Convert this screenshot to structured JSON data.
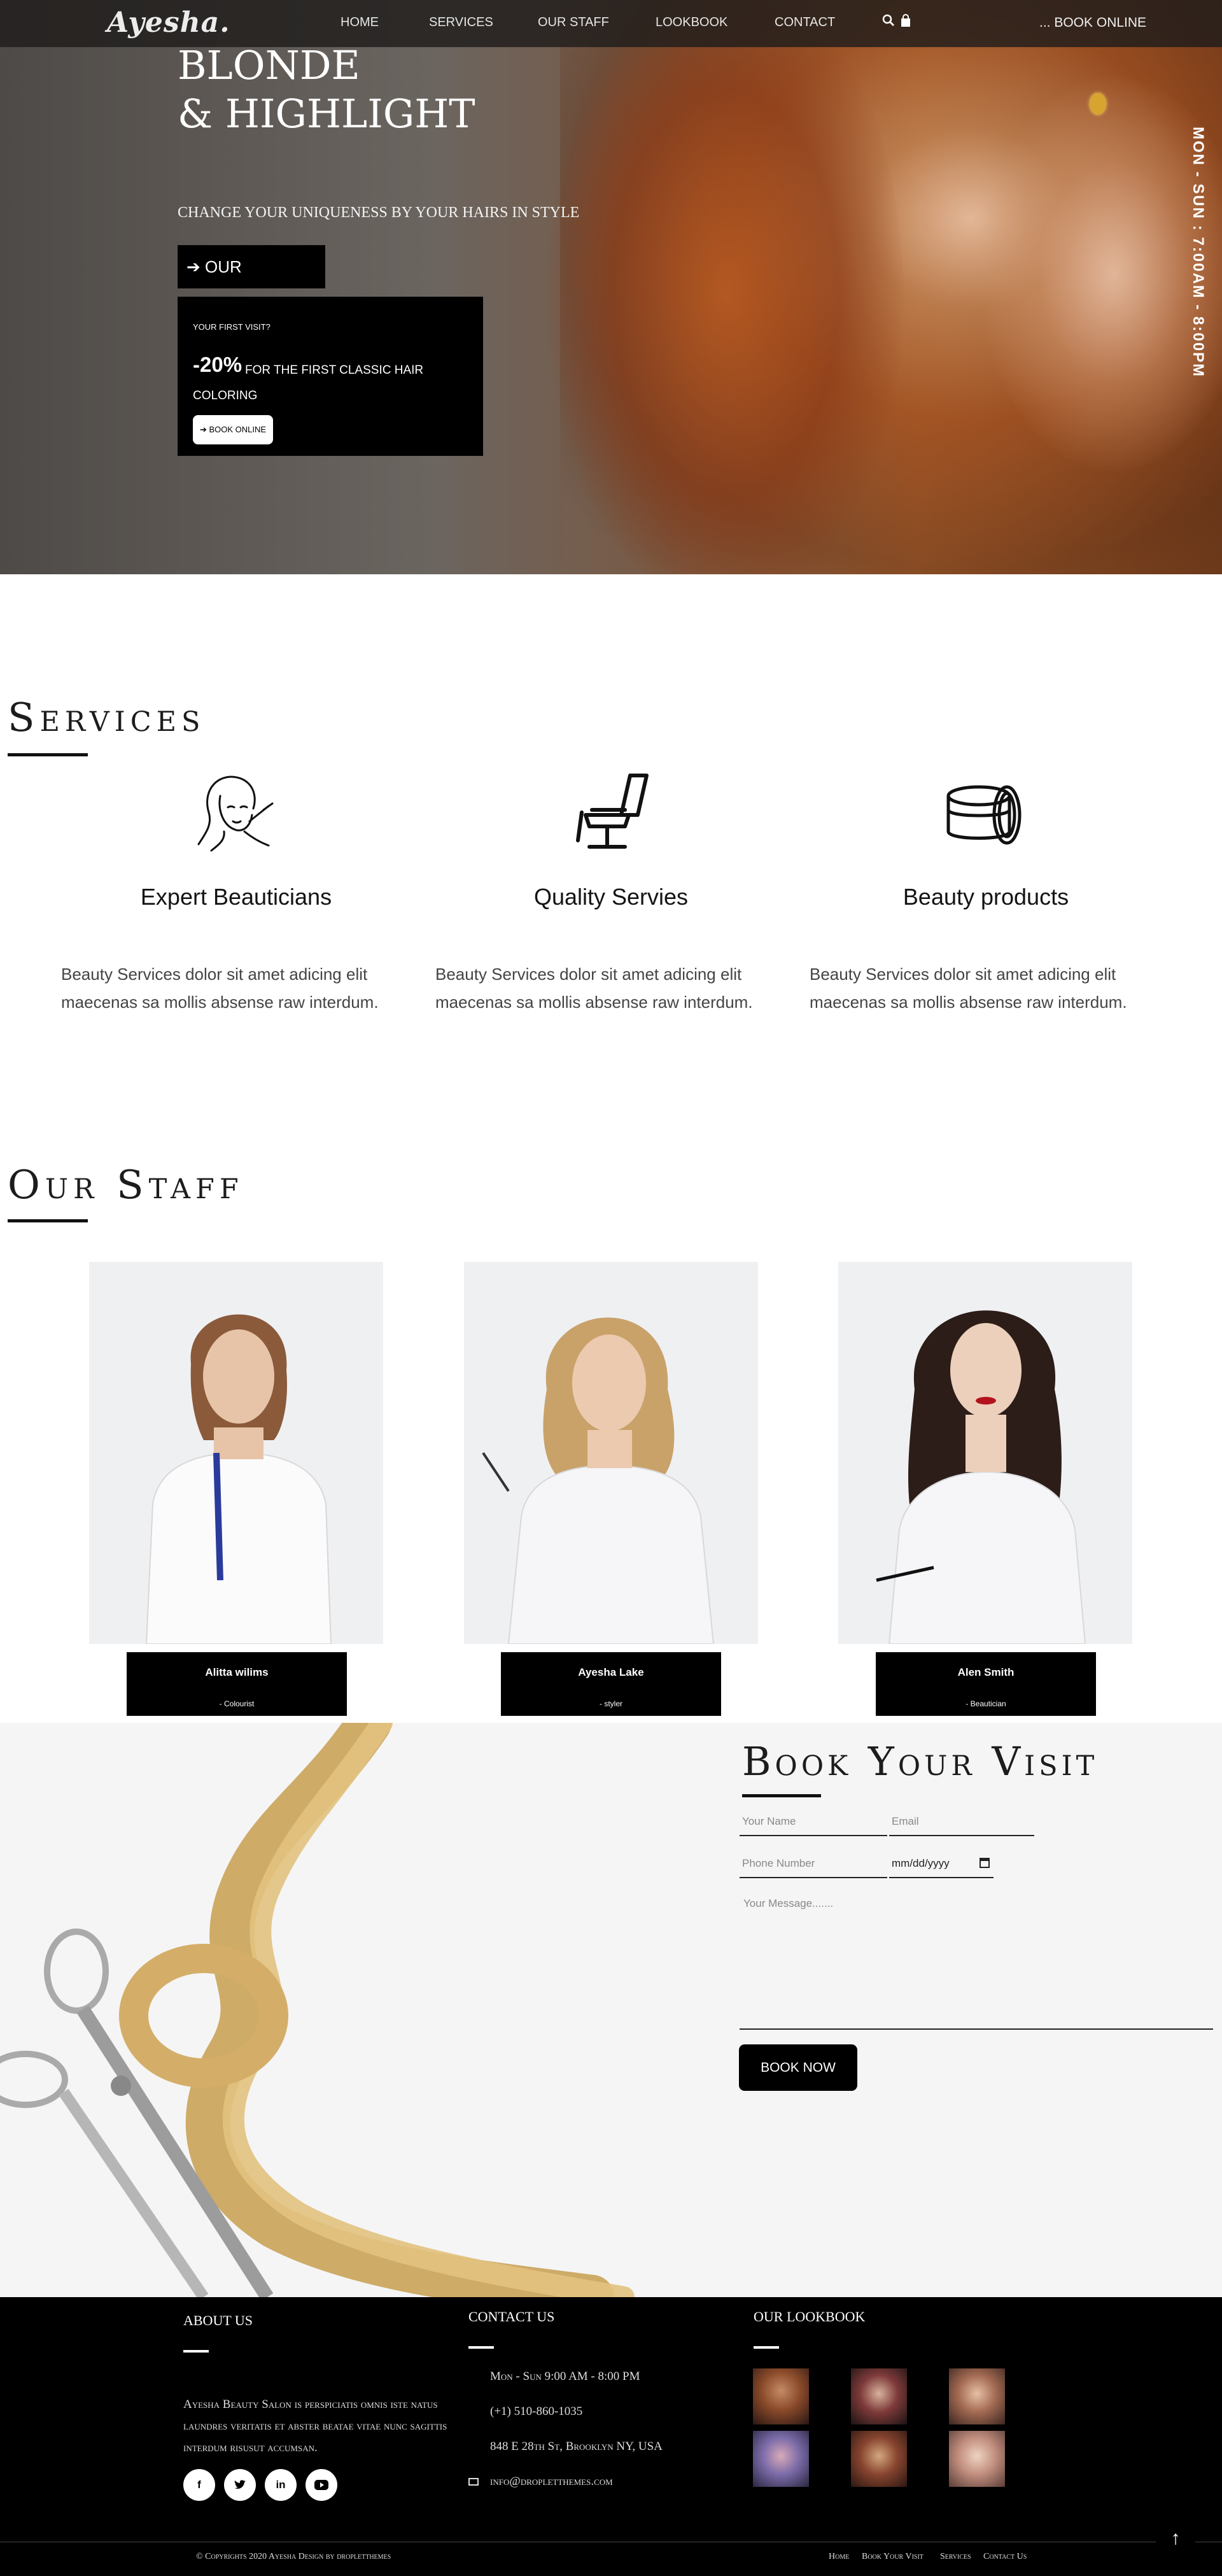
{
  "nav": {
    "logo": "Ayesha.",
    "links": [
      "HOME",
      "SERVICES",
      "OUR STAFF",
      "LOOKBOOK",
      "CONTACT"
    ],
    "icons": [
      "search-icon",
      "cart-icon"
    ],
    "book_online": "... BOOK ONLINE"
  },
  "hero": {
    "title_line1": "BLONDE",
    "title_line2": "& HIGHLIGHT",
    "subtitle": "CHANGE YOUR UNIQUENESS BY YOUR HAIRS IN STYLE",
    "services_button": "OUR SERVICES",
    "promo": {
      "small": "YOUR FIRST VISIT?",
      "percent": "-20%",
      "text": "FOR THE FIRST CLASSIC HAIR COLORING",
      "button": "BOOK ONLINE"
    },
    "hours": "MON - SUN : 7:00AM - 8:00PM"
  },
  "services": {
    "title": "Services",
    "items": [
      {
        "icon": "makeup-woman-icon",
        "title": "Expert Beauticians",
        "desc": "Beauty Services dolor sit amet adicing elit maecenas sa mollis absense raw interdum."
      },
      {
        "icon": "salon-chair-icon",
        "title": "Quality Servies",
        "desc": "Beauty Services dolor sit amet adicing elit maecenas sa mollis absense raw interdum."
      },
      {
        "icon": "cream-jar-icon",
        "title": "Beauty products",
        "desc": "Beauty Services dolor sit amet adicing elit maecenas sa mollis absense raw interdum."
      }
    ]
  },
  "staff": {
    "title": "Our Staff",
    "members": [
      {
        "name": "Alitta wilims",
        "role": "- Colourist"
      },
      {
        "name": "Ayesha Lake",
        "role": "- styler"
      },
      {
        "name": "Alen Smith",
        "role": "- Beautician"
      }
    ]
  },
  "book": {
    "title": "Book Your Visit",
    "name_placeholder": "Your Name",
    "email_placeholder": "Email",
    "phone_placeholder": "Phone Number",
    "date_placeholder": "mm/dd/yyyy",
    "message_placeholder": "Your Message.......",
    "button": "BOOK NOW"
  },
  "footer": {
    "about_title": "ABOUT US",
    "about_text": "Ayesha Beauty Salon is perspiciatis omnis iste natus laundres veritatis et abster beatae vitae nunc sagittis interdum risusut accumsan.",
    "social": [
      "facebook-icon",
      "twitter-icon",
      "linkedin-icon",
      "youtube-icon"
    ],
    "contact_title": "CONTACT US",
    "hours": "Mon - Sun 9:00 AM - 8:00 PM",
    "phone": "(+1) 510-860-1035",
    "address": "848 E 28th St, Brooklyn NY, USA",
    "email": "info@dropletthemes.com",
    "lookbook_title": "OUR LOOKBOOK",
    "copyright": "© Copyrights 2020 Ayesha Design by dropletthemes",
    "links": [
      "Home",
      "Book Your Visit",
      "Services",
      "Contact Us"
    ]
  }
}
